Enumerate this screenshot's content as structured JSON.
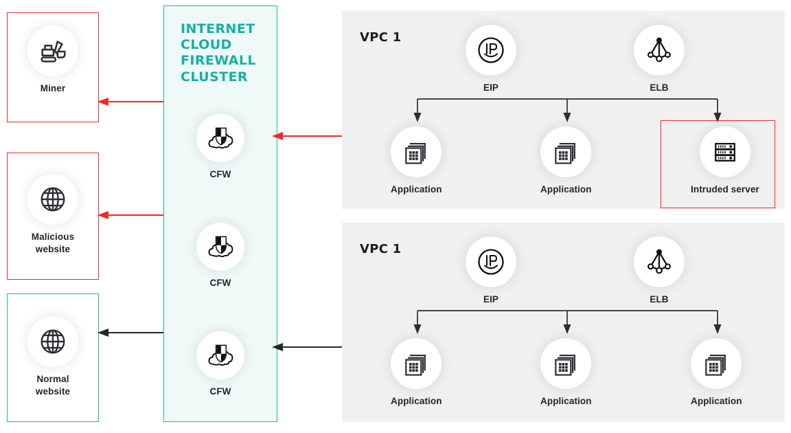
{
  "cluster": {
    "title": "INTERNET\nCLOUD\nFIREWALL\nCLUSTER",
    "accent_color": "#16b0a3",
    "fill_color": "#effaf8",
    "nodes": [
      {
        "label": "CFW",
        "icon": "cloud-shield-icon"
      },
      {
        "label": "CFW",
        "icon": "cloud-shield-icon"
      },
      {
        "label": "CFW",
        "icon": "cloud-shield-icon"
      }
    ]
  },
  "threat_targets": [
    {
      "label": "Miner",
      "icon": "excavator-icon",
      "border_color": "#ee2a24",
      "status": "malicious"
    },
    {
      "label": "Malicious\nwebsite",
      "icon": "globe-icon",
      "border_color": "#ee2a24",
      "status": "malicious"
    },
    {
      "label": "Normal\nwebsite",
      "icon": "globe-icon",
      "border_color": "#1db3a6",
      "status": "normal"
    }
  ],
  "vpcs": [
    {
      "title": "VPC 1",
      "gateway": {
        "label": "EIP",
        "icon": "eip-icon"
      },
      "balancer": {
        "label": "ELB",
        "icon": "elb-icon"
      },
      "instances": [
        {
          "label": "Application",
          "icon": "application-icon",
          "highlighted": false
        },
        {
          "label": "Application",
          "icon": "application-icon",
          "highlighted": false
        },
        {
          "label": "Intruded server",
          "icon": "server-rack-icon",
          "highlighted": true,
          "highlight_color": "#ee2a24"
        }
      ]
    },
    {
      "title": "VPC 1",
      "gateway": {
        "label": "EIP",
        "icon": "eip-icon"
      },
      "balancer": {
        "label": "ELB",
        "icon": "elb-icon"
      },
      "instances": [
        {
          "label": "Application",
          "icon": "application-icon",
          "highlighted": false
        },
        {
          "label": "Application",
          "icon": "application-icon",
          "highlighted": false
        },
        {
          "label": "Application",
          "icon": "application-icon",
          "highlighted": false
        }
      ]
    }
  ],
  "flows": [
    {
      "name": "vpc1-to-cluster",
      "color": "#ee2a24",
      "direction": "left"
    },
    {
      "name": "cluster-to-miner",
      "color": "#ee2a24",
      "direction": "left"
    },
    {
      "name": "cluster-to-malicious-website",
      "color": "#ee2a24",
      "direction": "left"
    },
    {
      "name": "vpc2-to-cluster",
      "color": "#262626",
      "direction": "left"
    },
    {
      "name": "cluster-to-normal-website",
      "color": "#262626",
      "direction": "left"
    }
  ],
  "colors": {
    "red": "#ee2a24",
    "teal": "#1db3a6",
    "dark": "#262626",
    "panel_gray": "#f0f0f0"
  }
}
